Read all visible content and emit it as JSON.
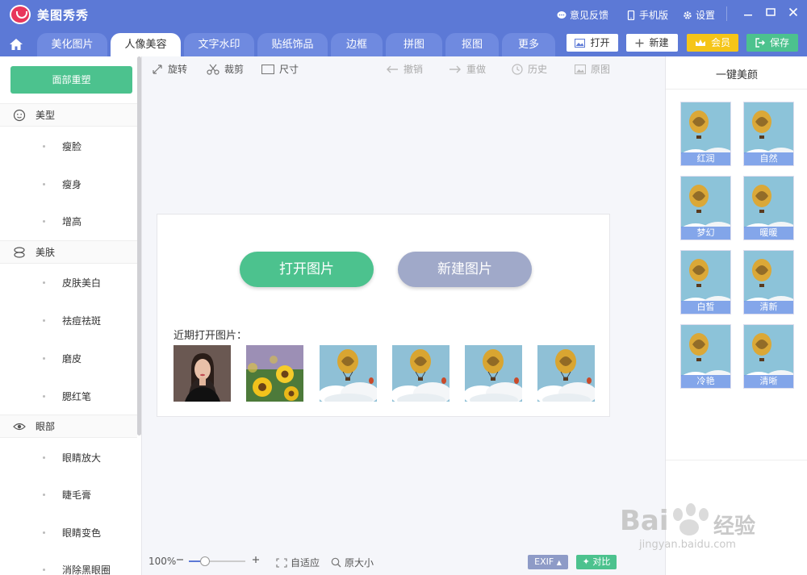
{
  "titlebar": {
    "app_title": "美图秀秀",
    "feedback": "意见反馈",
    "mobile": "手机版",
    "settings": "设置"
  },
  "tabs": [
    {
      "label": "美化图片"
    },
    {
      "label": "人像美容"
    },
    {
      "label": "文字水印"
    },
    {
      "label": "贴纸饰品"
    },
    {
      "label": "边框"
    },
    {
      "label": "拼图"
    },
    {
      "label": "抠图"
    },
    {
      "label": "更多"
    }
  ],
  "actions": {
    "open": "打开",
    "new": "新建",
    "vip": "会员",
    "save": "保存"
  },
  "sidebar": {
    "top_button": "面部重塑",
    "sections": [
      {
        "label": "美型",
        "items": [
          "瘦脸",
          "瘦身",
          "增高"
        ]
      },
      {
        "label": "美肤",
        "items": [
          "皮肤美白",
          "祛痘祛斑",
          "磨皮",
          "腮红笔"
        ]
      },
      {
        "label": "眼部",
        "items": [
          "眼睛放大",
          "睫毛膏",
          "眼睛变色",
          "消除黑眼圈"
        ]
      }
    ]
  },
  "toolbar": {
    "rotate": "旋转",
    "crop": "裁剪",
    "size": "尺寸",
    "undo": "撤销",
    "redo": "重做",
    "history": "历史",
    "original": "原图"
  },
  "center": {
    "open_image": "打开图片",
    "new_image": "新建图片",
    "recent_label": "近期打开图片："
  },
  "right_panel": {
    "title": "一键美颜",
    "effects": [
      "红润",
      "自然",
      "梦幻",
      "暖暖",
      "白皙",
      "清新",
      "冷艳",
      "清晰"
    ]
  },
  "bottom": {
    "zoom": "100%",
    "zoom_level": 0.28,
    "fit": "自适应",
    "actual_size": "原大小",
    "exif": "EXIF",
    "compare": "对比"
  },
  "watermark": {
    "brand": "Bai",
    "brand_cn": "经验",
    "url": "jingyan.baidu.com"
  },
  "colors": {
    "primary": "#5c79d6",
    "green": "#4cc28e",
    "gray_button": "#a0a9c9",
    "vip": "#f5c518",
    "logo": "#e8375b"
  }
}
